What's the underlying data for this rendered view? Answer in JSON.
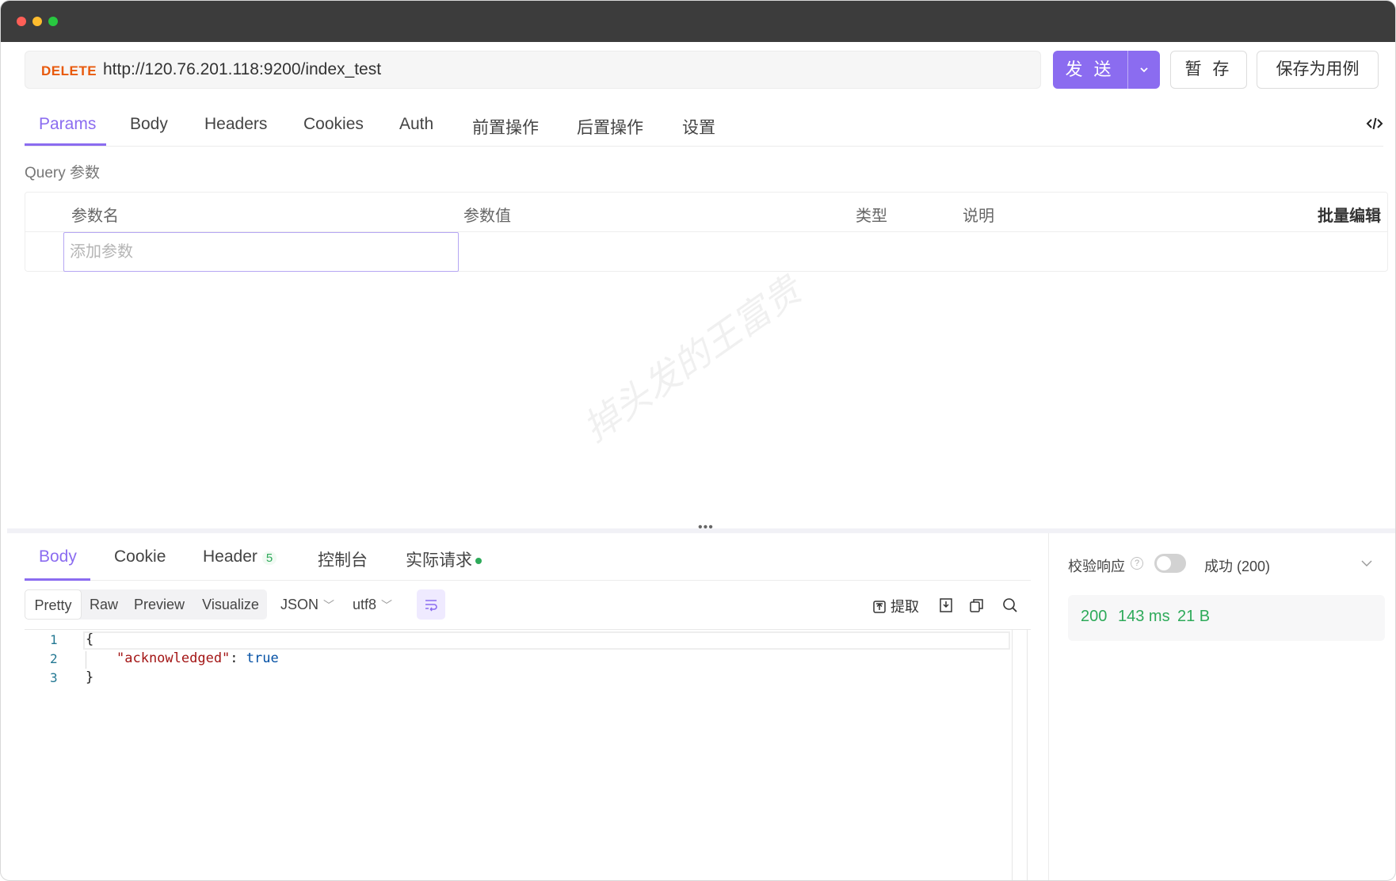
{
  "request": {
    "method": "DELETE",
    "url": "http://120.76.201.118:9200/index_test",
    "send_label": "发 送",
    "save_draft_label": "暂 存",
    "save_example_label": "保存为用例",
    "method_color": "#e8590c",
    "accent_color": "#8b6cf0"
  },
  "request_tabs": [
    {
      "label": "Params",
      "active": true
    },
    {
      "label": "Body"
    },
    {
      "label": "Headers"
    },
    {
      "label": "Cookies"
    },
    {
      "label": "Auth"
    },
    {
      "label": "前置操作"
    },
    {
      "label": "后置操作"
    },
    {
      "label": "设置"
    }
  ],
  "query": {
    "section_label": "Query 参数",
    "columns": [
      "参数名",
      "参数值",
      "类型",
      "说明"
    ],
    "bulk_edit_label": "批量编辑",
    "add_placeholder": "添加参数"
  },
  "watermark": "掉头发的王富贵",
  "response_tabs": [
    {
      "label": "Body",
      "active": true
    },
    {
      "label": "Cookie"
    },
    {
      "label": "Header",
      "badge": "5"
    },
    {
      "label": "控制台"
    },
    {
      "label": "实际请求",
      "dot": true
    }
  ],
  "response_toolbar": {
    "views": [
      "Pretty",
      "Raw",
      "Preview",
      "Visualize"
    ],
    "active_view": "Pretty",
    "format": "JSON",
    "encoding": "utf8",
    "extract_label": "提取",
    "icons": [
      "wrap-icon",
      "extract-icon",
      "download-icon",
      "copy-icon",
      "search-icon"
    ]
  },
  "response_body": {
    "line_numbers": [
      "1",
      "2",
      "3"
    ],
    "lines": [
      "{",
      "\"acknowledged\"",
      ": ",
      "true",
      "}"
    ]
  },
  "validation": {
    "label": "校验响应",
    "help": "?",
    "enabled": false,
    "status_option": "成功 (200)"
  },
  "metrics": {
    "status": "200",
    "time": "143 ms",
    "size": "21 B",
    "color": "#2eaa5a"
  }
}
